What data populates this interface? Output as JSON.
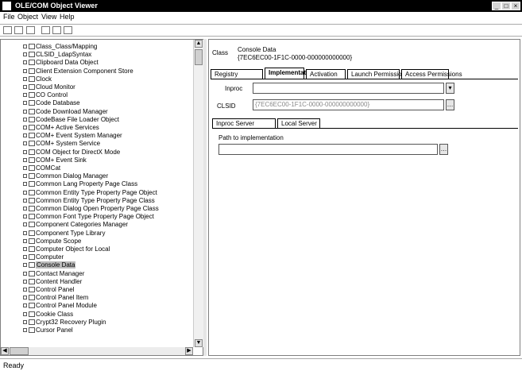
{
  "window": {
    "title": "OLE/COM Object Viewer"
  },
  "menu": [
    "File",
    "Object",
    "View",
    "Help"
  ],
  "tree": {
    "items": [
      "Class_Class/Mapping",
      "CLSID_LdapSyntax",
      "Clipboard Data Object",
      "Client Extension Component Store",
      "Clock",
      "Cloud Monitor",
      "CO Control",
      "Code Database",
      "Code Download Manager",
      "CodeBase File Loader Object",
      "COM+ Active Services",
      "COM+ Event System Manager",
      "COM+ System Service",
      "COM Object for DirectX Mode",
      "COM+ Event Sink",
      "COMCat",
      "Common Dialog Manager",
      "Common Lang Property Page Class",
      "Common Entity Type Property Page Object",
      "Common Entity Type Property Page Class",
      "Common Dialog Open Property Page Class",
      "Common Font Type Property Page Object",
      "Component Categories Manager",
      "Component Type Library",
      "Compute Scope",
      "Computer Object for Local",
      "Computer",
      "Console Data",
      "Contact Manager",
      "Content Handler",
      "Control Panel",
      "Control Panel Item",
      "Control Panel Module",
      "Cookie Class",
      "Crypt32 Recovery Plugin",
      "Cursor Panel"
    ],
    "selected_index": 27
  },
  "detail": {
    "heading_label": "Class",
    "class_name": "Console Data",
    "clsid": "{7EC6EC00-1F1C-0000-000000000000}",
    "tabs": [
      "Registry",
      "Implementation",
      "Activation",
      "Launch Permissions",
      "Access Permissions"
    ],
    "active_tab": 1,
    "field1_label": "Inproc",
    "field1_value": "",
    "field2_label": "CLSID",
    "field2_value": "{7EC6EC00-1F1C-0000-000000000000}",
    "subtabs": [
      "Inproc Server",
      "Local Server"
    ],
    "path_label": "Path to implementation",
    "path_value": ""
  },
  "status": {
    "text": "Ready"
  }
}
